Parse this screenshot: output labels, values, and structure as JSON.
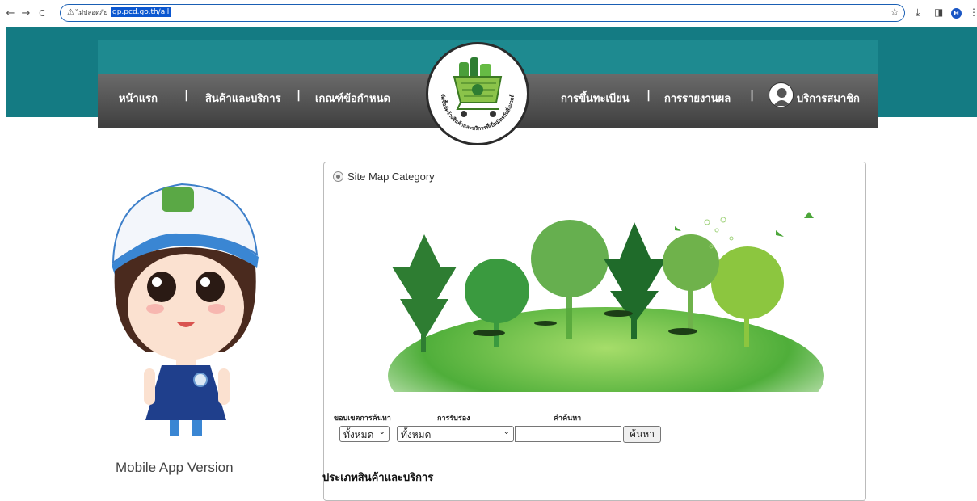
{
  "browser": {
    "back": "←",
    "forward": "→",
    "reload": "C",
    "security_warning": "ไม่ปลอดภัย",
    "url": "gp.pcd.go.th/all",
    "profile_initial": "H"
  },
  "nav": {
    "home": "หน้าแรก",
    "products": "สินค้าและบริการ",
    "criteria": "เกณฑ์ข้อกำหนด",
    "register": "การขึ้นทะเบียน",
    "report": "การรายงานผล",
    "member": "บริการสมาชิก",
    "separator": "|"
  },
  "logo": {
    "ring_text": "จัดซื้อจัดจ้างสินค้าและบริการที่เป็นมิตรกับสิ่งแวดล้อม"
  },
  "main": {
    "mobile_label": "Mobile App Version",
    "sitemap_label": "Site Map Category",
    "filters": {
      "scope_label": "ขอบเขตการค้นหา",
      "cert_label": "การรับรอง",
      "keyword_label": "คำค้นหา",
      "scope_value": "ทั้งหมด",
      "cert_value": "ทั้งหมด",
      "keyword_value": "",
      "search_button": "ค้นหา"
    },
    "category_heading": "ประเภทสินค้าและบริการ"
  },
  "colors": {
    "teal": "#147b83",
    "navbar": "#4d4d4d",
    "url_highlight": "#0b57d0"
  }
}
